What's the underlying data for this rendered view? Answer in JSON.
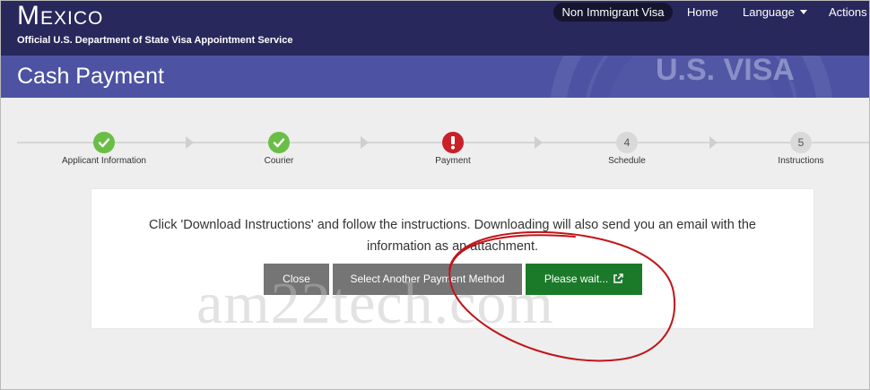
{
  "header": {
    "brand": "Mexico",
    "subtitle": "Official U.S. Department of State Visa Appointment Service",
    "nav": {
      "active": "Non Immigrant Visa",
      "home": "Home",
      "language": "Language",
      "actions": "Actions"
    }
  },
  "page": {
    "title": "Cash Payment",
    "seal_text": "U.S. VISA"
  },
  "stepper": {
    "steps": [
      {
        "label": "Applicant Information",
        "status": "done",
        "number": ""
      },
      {
        "label": "Courier",
        "status": "done",
        "number": ""
      },
      {
        "label": "Payment",
        "status": "alert",
        "number": ""
      },
      {
        "label": "Schedule",
        "status": "pending",
        "number": "4"
      },
      {
        "label": "Instructions",
        "status": "pending",
        "number": "5"
      }
    ]
  },
  "card": {
    "instructions": "Click 'Download Instructions' and follow the instructions. Downloading will also send you an email with the information as an attachment.",
    "buttons": {
      "close": "Close",
      "select_other": "Select Another Payment Method",
      "please_wait": "Please wait..."
    }
  },
  "watermark": "am22tech.com",
  "colors": {
    "navbar": "#28285c",
    "title_band": "#4d53a2",
    "done": "#6abe45",
    "alert": "#c9202a",
    "primary_button": "#1b7a2a",
    "secondary_button": "#757575",
    "annotation": "#c0151a"
  },
  "icons": {
    "done": "check-icon",
    "alert": "exclamation-icon",
    "wait_button": "external-link-icon"
  }
}
